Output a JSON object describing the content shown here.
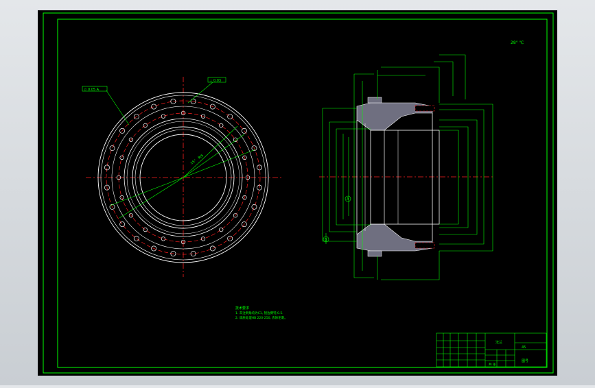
{
  "colors": {
    "canvas_bg": "#000000",
    "frame": "#00ff00",
    "outline": "#ffffff",
    "centerline": "#ff2020",
    "bolt_circle": "#ff2020",
    "dimension": "#00ff00",
    "leader": "#00ff00",
    "section_hatch": "#7a7a8a",
    "environment_bg": "#d4d8dc"
  },
  "drawing": {
    "scale_note": "28° ℃",
    "left_view": {
      "tolerance_label_a": "∅ 0.05 A",
      "tolerance_label_b": "⊥ 0.03",
      "angle_label": "15°",
      "radius_label": "R/5"
    },
    "right_view": {
      "datum_a": "A",
      "datum_b": "B"
    },
    "notes": {
      "title": "技术要求",
      "line_1": "1. 未注倒角均为C1, 锐边倒钝 0.5.",
      "line_2": "2. 调质处理HB 220-250, 去除毛刺。"
    },
    "title_block": {
      "part_name": "法兰",
      "material": "45",
      "sheet": "共 张",
      "drawing_no": "图号"
    }
  }
}
